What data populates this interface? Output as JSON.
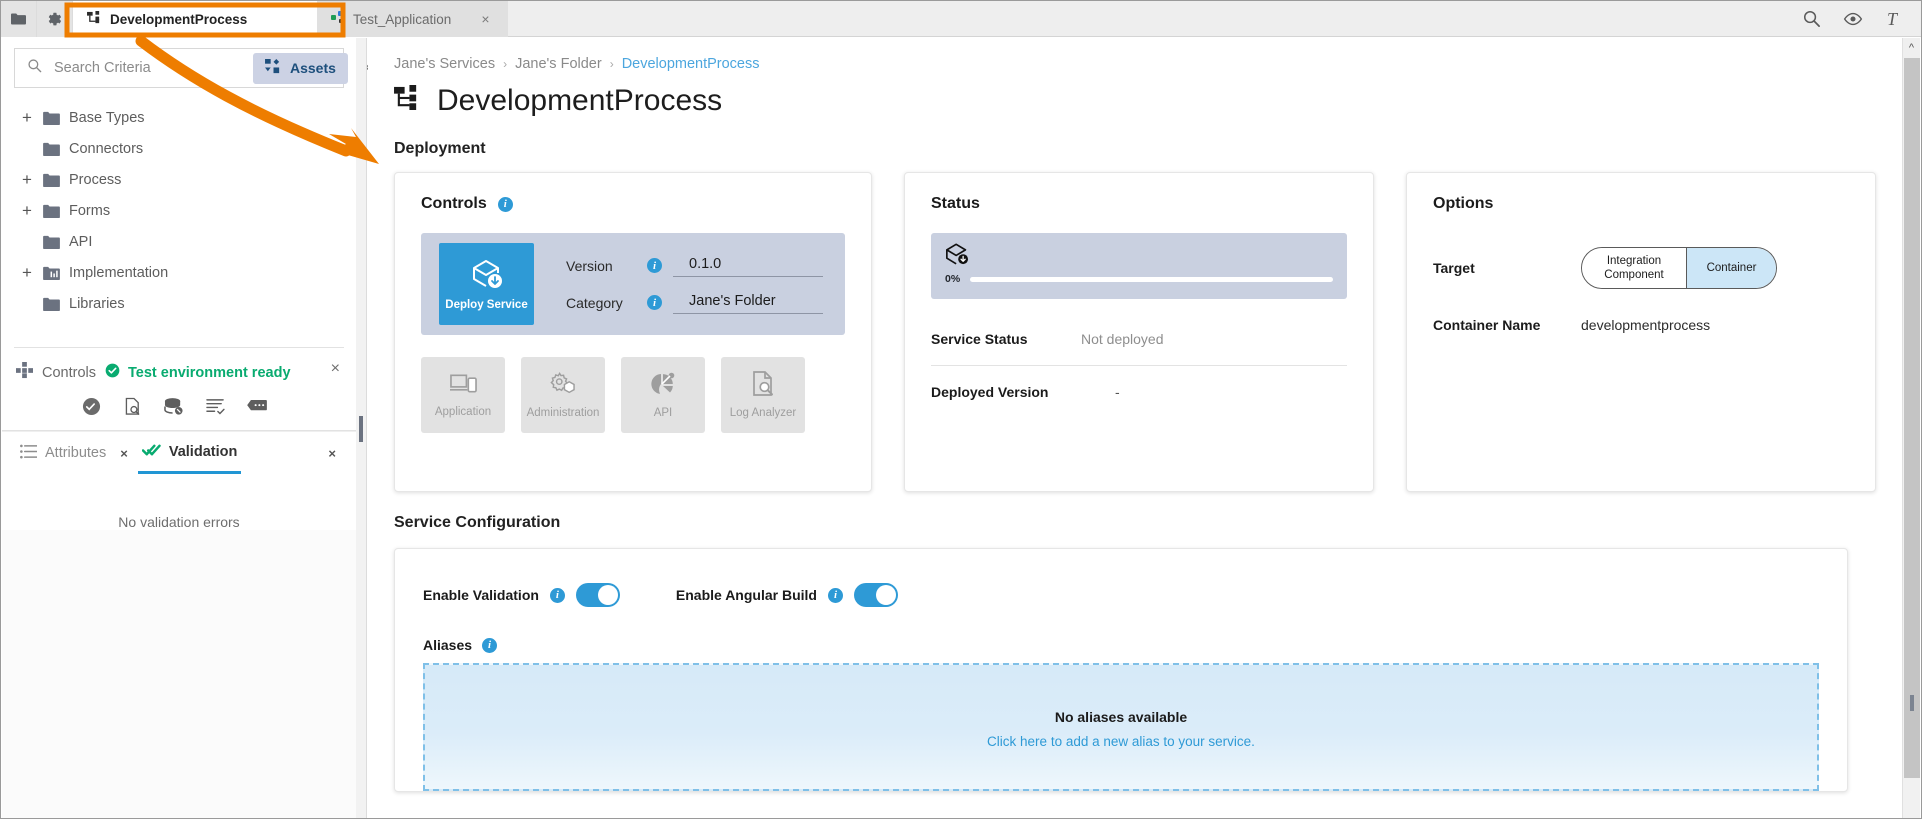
{
  "tabbar": {
    "buttons": [
      {
        "name": "folder-icon",
        "label": "Folder"
      },
      {
        "name": "gear-icon",
        "label": "Settings"
      }
    ],
    "tabs": [
      {
        "label": "DevelopmentProcess",
        "icon": "process-tree-icon",
        "active": true,
        "closable": false
      },
      {
        "label": "Test_Application",
        "icon": "application-icon",
        "active": false,
        "closable": true,
        "close_label": "×"
      }
    ],
    "right_icons": [
      {
        "name": "search-icon",
        "label": "Search"
      },
      {
        "name": "eye-icon",
        "label": "Preview"
      },
      {
        "name": "text-icon",
        "label": "T"
      }
    ]
  },
  "sidebar": {
    "search": {
      "placeholder": "Search Criteria",
      "value": ""
    },
    "assets_chip": {
      "label": "Assets",
      "icon": "assets-icon"
    },
    "search_clear": "×",
    "tree": [
      {
        "label": "Base Types",
        "expandable": true,
        "icon": "folder-icon"
      },
      {
        "label": "Connectors",
        "expandable": false,
        "icon": "folder-icon"
      },
      {
        "label": "Process",
        "expandable": true,
        "icon": "folder-icon"
      },
      {
        "label": "Forms",
        "expandable": true,
        "icon": "folder-icon"
      },
      {
        "label": "API",
        "expandable": false,
        "icon": "folder-icon"
      },
      {
        "label": "Implementation",
        "expandable": true,
        "icon": "folder-impl-icon"
      },
      {
        "label": "Libraries",
        "expandable": false,
        "icon": "folder-icon"
      }
    ],
    "expand_symbol": "+",
    "controls_panel": {
      "title": "Controls",
      "status_text": "Test environment ready",
      "close_label": "×",
      "icons": [
        {
          "name": "check-circle-icon"
        },
        {
          "name": "document-search-icon"
        },
        {
          "name": "database-stop-icon"
        },
        {
          "name": "list-check-icon"
        },
        {
          "name": "message-icon"
        }
      ]
    },
    "attributes_panel": {
      "tabs": [
        {
          "label": "Attributes",
          "icon": "list-icon",
          "selected": false,
          "close_label": "×"
        },
        {
          "label": "Validation",
          "icon": "double-check-icon",
          "selected": true,
          "close_label": "×"
        }
      ],
      "empty_message": "No validation errors"
    }
  },
  "main": {
    "breadcrumb": [
      {
        "label": "Jane's Services"
      },
      {
        "label": "Jane's Folder"
      },
      {
        "label": "DevelopmentProcess",
        "current": true
      }
    ],
    "breadcrumb_separator": "›",
    "page_title": "DevelopmentProcess",
    "page_title_icon": "process-tree-icon",
    "deployment": {
      "section_title": "Deployment",
      "controls_card": {
        "title": "Controls",
        "deploy_button": {
          "label": "Deploy Service",
          "icon": "deploy-box-icon"
        },
        "fields": [
          {
            "label": "Version",
            "value": "0.1.0"
          },
          {
            "label": "Category",
            "value": "Jane's Folder"
          }
        ],
        "tiles": [
          {
            "label": "Application",
            "icon": "devices-icon"
          },
          {
            "label": "Administration",
            "icon": "gear-box-icon"
          },
          {
            "label": "API",
            "icon": "api-pie-icon"
          },
          {
            "label": "Log Analyzer",
            "icon": "document-search-icon"
          }
        ]
      },
      "status_card": {
        "title": "Status",
        "progress_percent": "0%",
        "progress_value": 0,
        "progress_icon": "deploy-box-icon",
        "rows": [
          {
            "key": "Service Status",
            "value": "Not deployed"
          },
          {
            "key": "Deployed Version",
            "value": "-"
          }
        ]
      },
      "options_card": {
        "title": "Options",
        "target_label": "Target",
        "target_options": [
          {
            "label": "Integration Component",
            "selected": false
          },
          {
            "label": "Container",
            "selected": true
          }
        ],
        "container_name_label": "Container Name",
        "container_name_value": "developmentprocess"
      }
    },
    "service_configuration": {
      "section_title": "Service Configuration",
      "toggles": [
        {
          "label": "Enable Validation",
          "on": true
        },
        {
          "label": "Enable Angular Build",
          "on": true
        }
      ],
      "aliases_label": "Aliases",
      "aliases_empty_title": "No aliases available",
      "aliases_empty_link": "Click here to add a new alias to your service."
    }
  },
  "colors": {
    "accent_blue": "#2e9ad6",
    "annotation_orange": "#ee7d00",
    "status_green": "#09ab70",
    "panel_lavender": "#c9d0e0",
    "link_blue": "#4ca6de"
  }
}
